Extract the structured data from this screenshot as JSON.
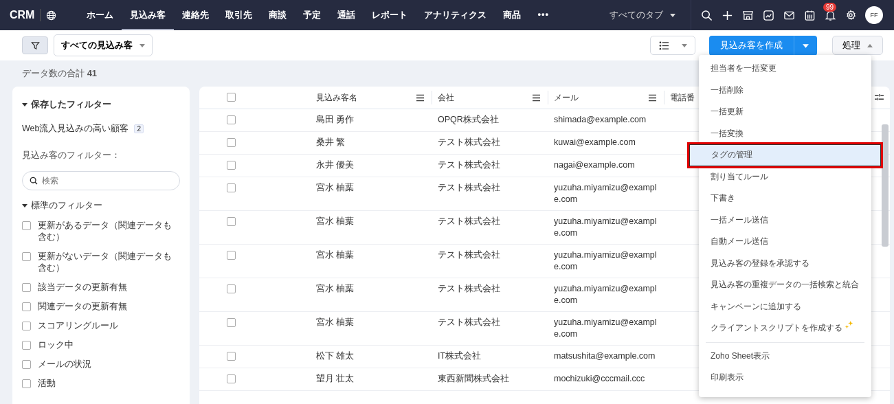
{
  "app": {
    "logo": "CRM"
  },
  "nav": [
    {
      "label": "ホーム",
      "selected": false
    },
    {
      "label": "見込み客",
      "selected": true
    },
    {
      "label": "連絡先",
      "selected": false
    },
    {
      "label": "取引先",
      "selected": false
    },
    {
      "label": "商談",
      "selected": false
    },
    {
      "label": "予定",
      "selected": false
    },
    {
      "label": "通話",
      "selected": false
    },
    {
      "label": "レポート",
      "selected": false
    },
    {
      "label": "アナリティクス",
      "selected": false
    },
    {
      "label": "商品",
      "selected": false
    }
  ],
  "nav_more": "•••",
  "all_tabs": "すべてのタブ",
  "notification_count": "99",
  "avatar": "FF",
  "toolbar": {
    "view": "すべての見込み客",
    "create_button": "見込み客を作成",
    "action_button": "処理"
  },
  "total": {
    "label": "データ数の合計",
    "count": "41"
  },
  "sidebar": {
    "saved_title": "保存したフィルター",
    "saved": [
      {
        "label": "Web流入見込みの高い顧客",
        "count": "2"
      }
    ],
    "filter_title": "見込み客のフィルター：",
    "search_placeholder": "検索",
    "standard_title": "標準のフィルター",
    "filters": [
      {
        "label": "更新があるデータ（関連データも含む）",
        "checked": false
      },
      {
        "label": "更新がないデータ（関連データも含む）",
        "checked": false
      },
      {
        "label": "該当データの更新有無",
        "checked": false
      },
      {
        "label": "関連データの更新有無",
        "checked": false
      },
      {
        "label": "スコアリングルール",
        "checked": false
      },
      {
        "label": "ロック中",
        "checked": false
      },
      {
        "label": "メールの状況",
        "checked": false
      },
      {
        "label": "活動",
        "checked": false
      }
    ]
  },
  "table": {
    "select_all_checked": false,
    "columns": [
      "見込み客名",
      "会社",
      "メール",
      "電話番"
    ],
    "rows": [
      {
        "name": "島田 勇作",
        "company": "OPQR株式会社",
        "email": "shimada@example.com",
        "checked": false
      },
      {
        "name": "桑井 繁",
        "company": "テスト株式会社",
        "email": "kuwai@example.com",
        "checked": false
      },
      {
        "name": "永井 優美",
        "company": "テスト株式会社",
        "email": "nagai@example.com",
        "checked": false
      },
      {
        "name": "宮水 柚葉",
        "company": "テスト株式会社",
        "email": "yuzuha.miyamizu@exampl e.com",
        "checked": false
      },
      {
        "name": "宮水 柚葉",
        "company": "テスト株式会社",
        "email": "yuzuha.miyamizu@exampl e.com",
        "checked": false
      },
      {
        "name": "宮水 柚葉",
        "company": "テスト株式会社",
        "email": "yuzuha.miyamizu@exampl e.com",
        "checked": false
      },
      {
        "name": "宮水 柚葉",
        "company": "テスト株式会社",
        "email": "yuzuha.miyamizu@exampl e.com",
        "checked": false
      },
      {
        "name": "宮水 柚葉",
        "company": "テスト株式会社",
        "email": "yuzuha.miyamizu@exampl e.com",
        "checked": false
      },
      {
        "name": "松下 雄太",
        "company": "IT株式会社",
        "email": "matsushita@example.com",
        "checked": false
      },
      {
        "name": "望月 壮太",
        "company": "東西新聞株式会社",
        "email": "mochizuki@cccmail.ccc",
        "checked": false
      }
    ]
  },
  "action_menu": {
    "items": [
      {
        "label": "担当者を一括変更",
        "selected": false,
        "kind": "item"
      },
      {
        "label": "一括削除",
        "selected": false,
        "kind": "item"
      },
      {
        "label": "一括更新",
        "selected": false,
        "kind": "item"
      },
      {
        "label": "一括変換",
        "selected": false,
        "kind": "item"
      },
      {
        "label": "タグの管理",
        "selected": true,
        "highlighted": true,
        "kind": "item"
      },
      {
        "label": "割り当てルール",
        "selected": false,
        "kind": "item"
      },
      {
        "label": "下書き",
        "selected": false,
        "kind": "item"
      },
      {
        "label": "一括メール送信",
        "selected": false,
        "kind": "item"
      },
      {
        "label": "自動メール送信",
        "selected": false,
        "kind": "item"
      },
      {
        "label": "見込み客の登録を承認する",
        "selected": false,
        "kind": "item"
      },
      {
        "label": "見込み客の重複データの一括検索と統合",
        "selected": false,
        "kind": "item"
      },
      {
        "label": "キャンペーンに追加する",
        "selected": false,
        "kind": "item"
      },
      {
        "label": "クライアントスクリプトを作成する",
        "selected": false,
        "kind": "ai"
      },
      {
        "label": "Zoho Sheet表示",
        "selected": false,
        "kind": "item",
        "divider_before": true
      },
      {
        "label": "印刷表示",
        "selected": false,
        "kind": "item"
      }
    ]
  }
}
